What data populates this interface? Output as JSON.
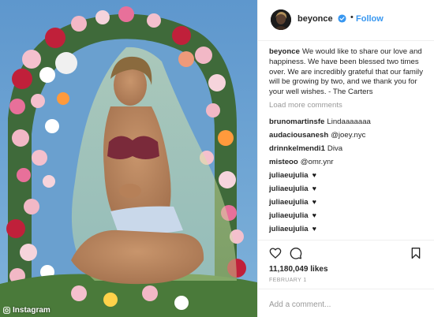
{
  "post": {
    "author": {
      "username": "beyonce",
      "verified": true,
      "follow_label": "Follow"
    },
    "caption": {
      "username": "beyonce",
      "text": "We would like to share our love and happiness. We have been blessed two times over. We are incredibly grateful that our family will be growing by two, and we thank you for your well wishes. - The Carters"
    },
    "load_more_label": "Load more comments",
    "comments": [
      {
        "username": "brunomartinsfe",
        "text": "Lindaaaaaaa"
      },
      {
        "username": "audaciousanesh",
        "text": "@joey.nyc"
      },
      {
        "username": "drinnkelmendi1",
        "text": "Diva"
      },
      {
        "username": "misteoo",
        "text": "@omr.ynr"
      },
      {
        "username": "juliaeujulia",
        "text": "♥",
        "emoji": true
      },
      {
        "username": "juliaeujulia",
        "text": "♥",
        "emoji": true
      },
      {
        "username": "juliaeujulia",
        "text": "♥",
        "emoji": true
      },
      {
        "username": "juliaeujulia",
        "text": "♥",
        "emoji": true
      },
      {
        "username": "juliaeujulia",
        "text": "♥",
        "emoji": true
      }
    ],
    "actions": {
      "like_icon": "heart-icon",
      "comment_icon": "comment-icon",
      "save_icon": "bookmark-icon"
    },
    "likes_label": "11,180,049 likes",
    "date_label": "FEBRUARY 1",
    "add_comment_placeholder": "Add a comment...",
    "watermark": "Instagram",
    "colors": {
      "link_blue": "#3897f0",
      "text": "#262626",
      "muted": "#999999",
      "verified_blue": "#3897f0"
    }
  }
}
